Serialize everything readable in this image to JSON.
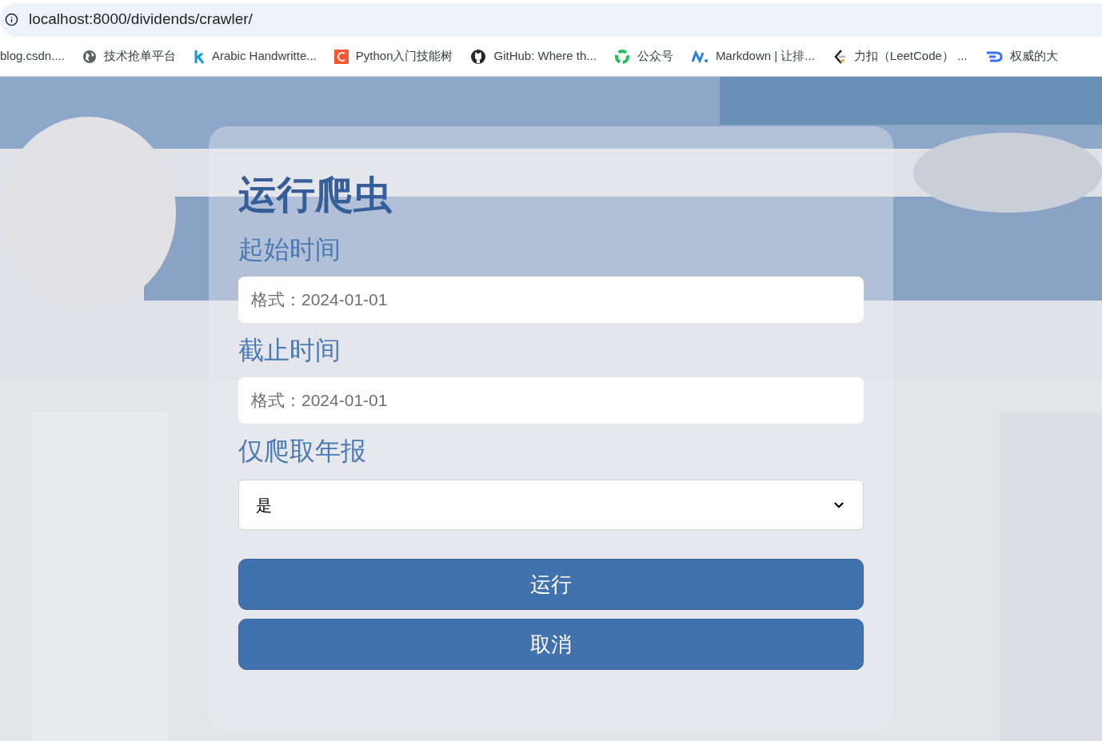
{
  "browser": {
    "url": "localhost:8000/dividends/crawler/",
    "bookmarks": [
      {
        "label": "blog.csdn...."
      },
      {
        "label": "技术抢单平台"
      },
      {
        "label": "Arabic Handwritte..."
      },
      {
        "label": "Python入门技能树"
      },
      {
        "label": "GitHub: Where th..."
      },
      {
        "label": "公众号"
      },
      {
        "label": "Markdown | 让排..."
      },
      {
        "label": "力扣（LeetCode） ..."
      },
      {
        "label": "权威的大"
      }
    ]
  },
  "form": {
    "title": "运行爬虫",
    "fields": [
      {
        "kind": "text",
        "label": "起始时间",
        "placeholder": "格式：2024-01-01"
      },
      {
        "kind": "text",
        "label": "截止时间",
        "placeholder": "格式：2024-01-01"
      },
      {
        "kind": "select",
        "label": "仅爬取年报",
        "value": "是"
      }
    ],
    "buttons": [
      "运行",
      "取消"
    ]
  }
}
